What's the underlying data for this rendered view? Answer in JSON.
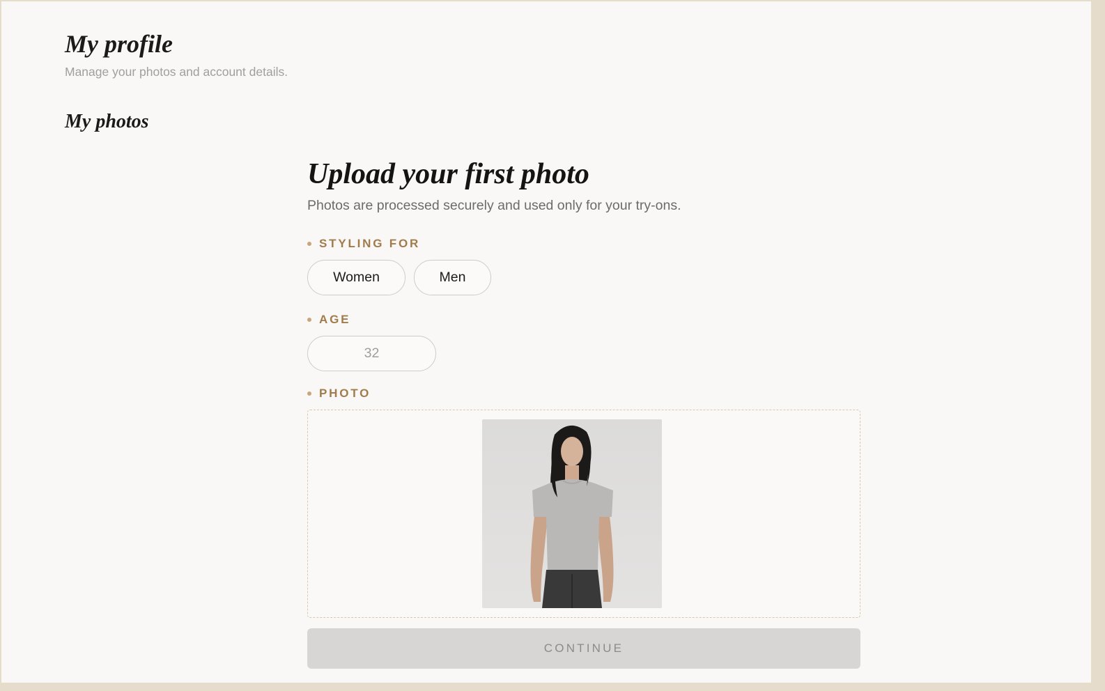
{
  "header": {
    "title": "My profile",
    "subtitle": "Manage your photos and account details."
  },
  "photos_section": {
    "title": "My photos"
  },
  "upload": {
    "title": "Upload your first photo",
    "subtitle": "Photos are processed securely and used only for your try-ons.",
    "styling_for": {
      "label": "STYLING FOR",
      "options": [
        "Women",
        "Men"
      ]
    },
    "age": {
      "label": "AGE",
      "placeholder": "32"
    },
    "photo": {
      "label": "PHOTO",
      "content": "uploaded-photo"
    },
    "continue_label": "CONTINUE"
  },
  "colors": {
    "accent_label": "#a07c4d",
    "dot": "#c9a67a",
    "button_disabled_bg": "#d7d6d4",
    "background": "#f9f8f6"
  }
}
